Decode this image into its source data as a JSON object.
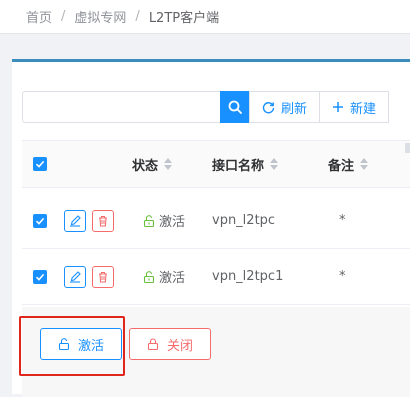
{
  "breadcrumb": {
    "items": [
      "首页",
      "虚拟专网",
      "L2TP客户端"
    ],
    "separator": "/"
  },
  "toolbar": {
    "search_placeholder": "",
    "search_value": "",
    "refresh_label": "刷新",
    "new_label": "新建"
  },
  "table": {
    "columns": [
      "状态",
      "接口名称",
      "备注"
    ],
    "rows": [
      {
        "selected": true,
        "status": "激活",
        "interface_name": "vpn_l2tpc",
        "remark": "*"
      },
      {
        "selected": true,
        "status": "激活",
        "interface_name": "vpn_l2tpc1",
        "remark": "*"
      }
    ]
  },
  "actions": {
    "activate_label": "激活",
    "close_label": "关闭"
  },
  "colors": {
    "primary": "#1890ff",
    "danger": "#f56c6c",
    "success": "#67c23a",
    "highlight": "#e0261a"
  }
}
